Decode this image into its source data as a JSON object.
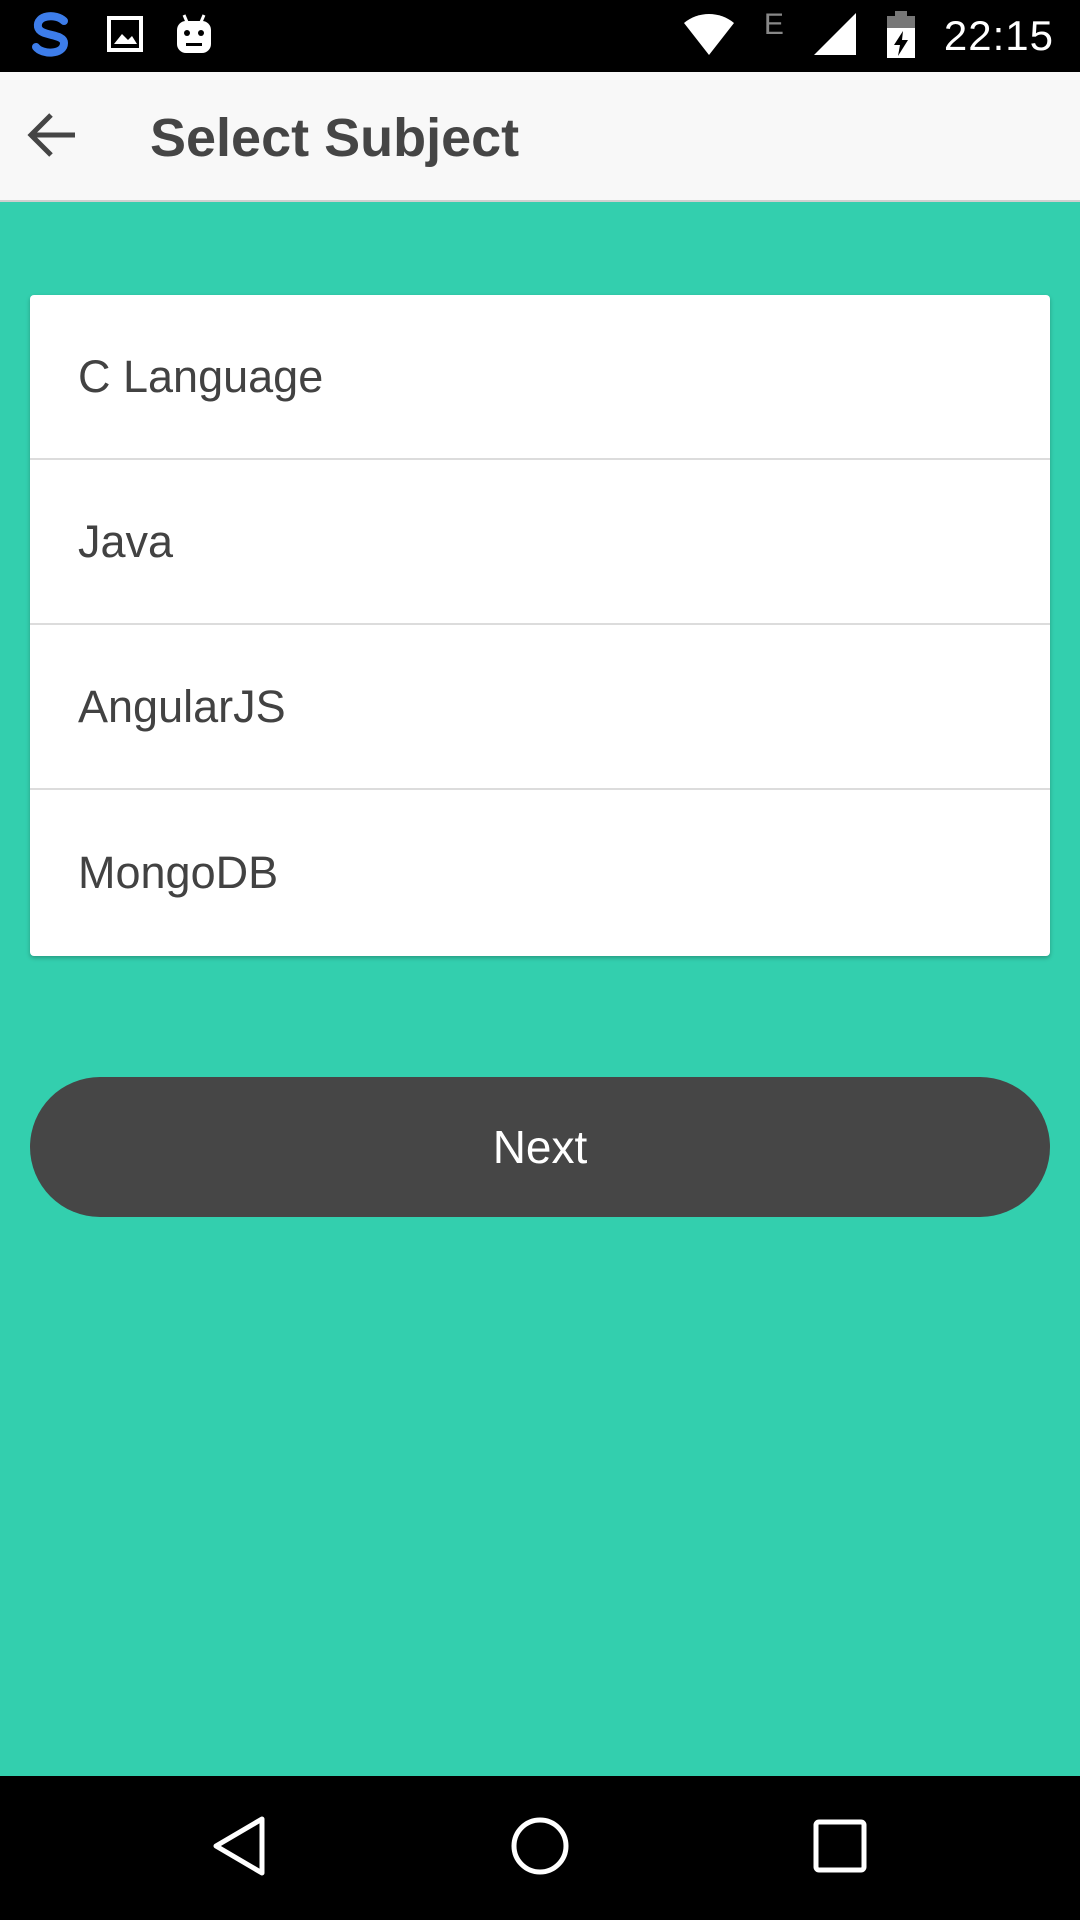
{
  "status_bar": {
    "time": "22:15",
    "network_label": "E",
    "left_icons": [
      "swiftkey-icon",
      "image-icon",
      "android-icon"
    ],
    "right_icons": [
      "wifi-icon",
      "signal-icon",
      "battery-charging-icon"
    ]
  },
  "app_bar": {
    "title": "Select Subject",
    "back_icon": "arrow-back-icon"
  },
  "subjects": {
    "items": [
      {
        "label": "C Language"
      },
      {
        "label": "Java"
      },
      {
        "label": "AngularJS"
      },
      {
        "label": "MongoDB"
      }
    ]
  },
  "actions": {
    "next_label": "Next"
  },
  "nav_bar": {
    "icons": [
      "nav-back-icon",
      "nav-home-icon",
      "nav-recents-icon"
    ]
  },
  "colors": {
    "background": "#33cfae",
    "button": "#464646",
    "title_text": "#454545"
  }
}
